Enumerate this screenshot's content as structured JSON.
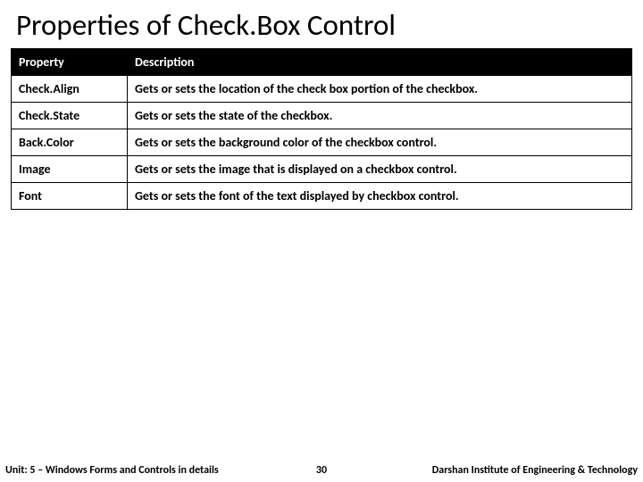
{
  "title": "Properties of Check.Box Control",
  "headers": {
    "property": "Property",
    "description": "Description"
  },
  "rows": [
    {
      "property": "Check.Align",
      "description": "Gets or sets the location of the check box portion of the checkbox."
    },
    {
      "property": "Check.State",
      "description": "Gets or sets the state of the checkbox."
    },
    {
      "property": "Back.Color",
      "description": "Gets or sets the background color of the checkbox control."
    },
    {
      "property": "Image",
      "description": "Gets or sets the image that is displayed on a checkbox control."
    },
    {
      "property": "Font",
      "description": "Gets or sets the font of the text displayed by checkbox control."
    }
  ],
  "footer": {
    "unit": "Unit: 5 – Windows Forms and Controls in details",
    "page": "30",
    "institute": "Darshan Institute of Engineering & Technology"
  }
}
